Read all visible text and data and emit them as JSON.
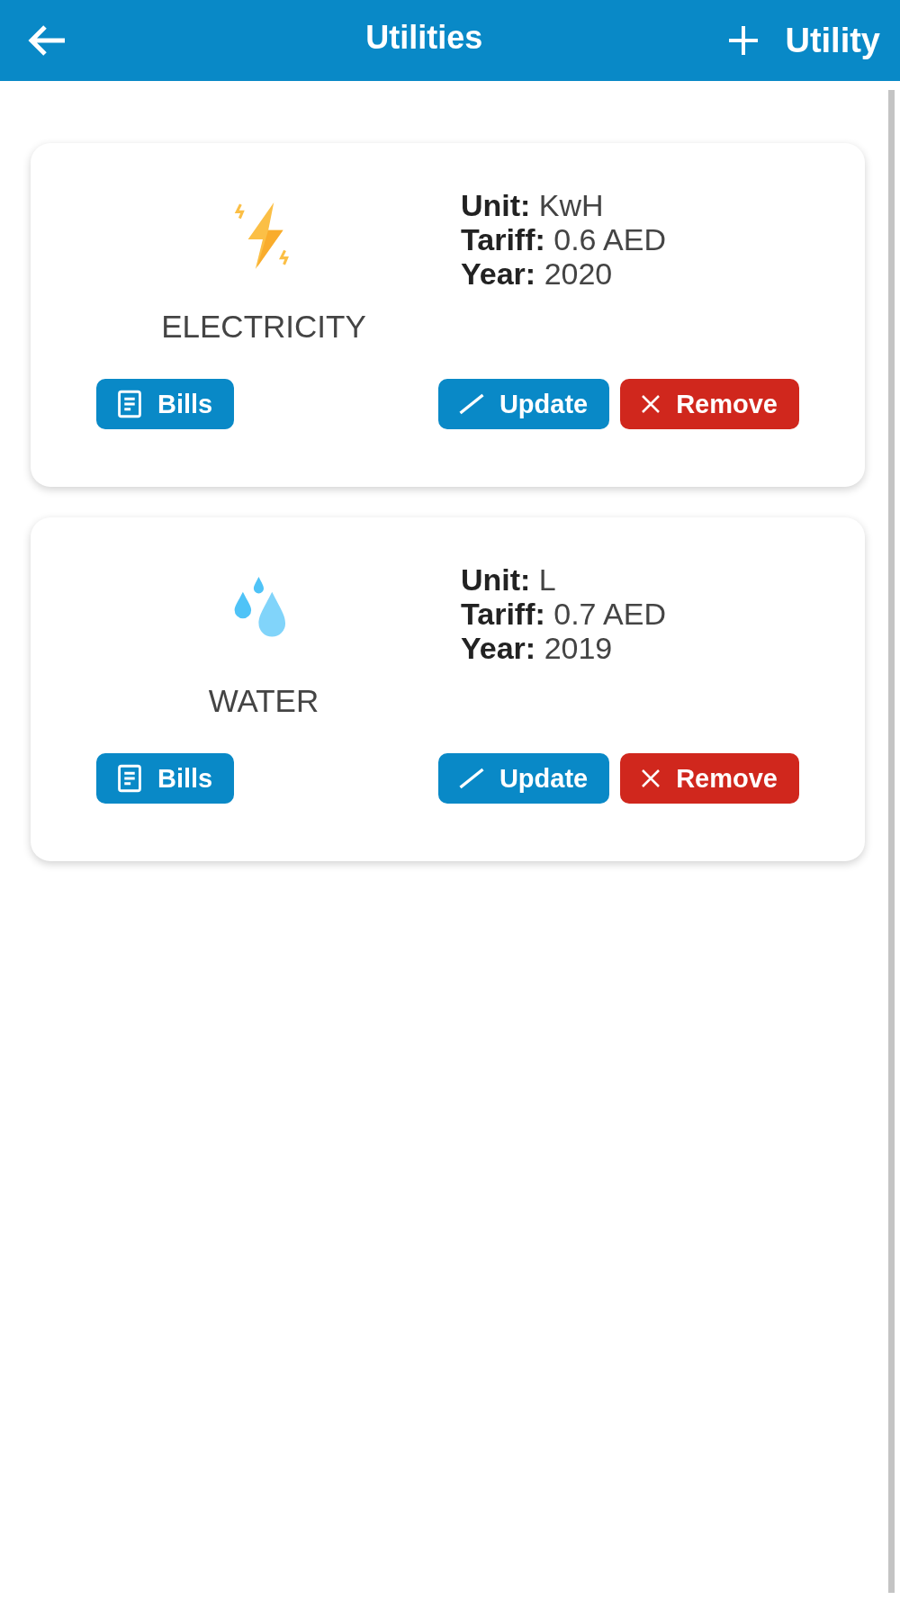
{
  "header": {
    "title": "Utilities",
    "add_label": "Utility"
  },
  "utilities": [
    {
      "kind": "electricity",
      "name": "ELECTRICITY",
      "details": [
        "**Unit:** KwH",
        "**Tariff:** 0.6 AED",
        "**Year:** 2020"
      ],
      "buttons": [
        "Bills",
        "Update",
        "Remove"
      ]
    },
    {
      "kind": "water",
      "name": "WATER",
      "details": [
        "**Unit:** L",
        "**Tariff:** 0.7 AED",
        "**Year:** 2019"
      ],
      "buttons": [
        "Bills",
        "Update",
        "Remove"
      ]
    }
  ]
}
